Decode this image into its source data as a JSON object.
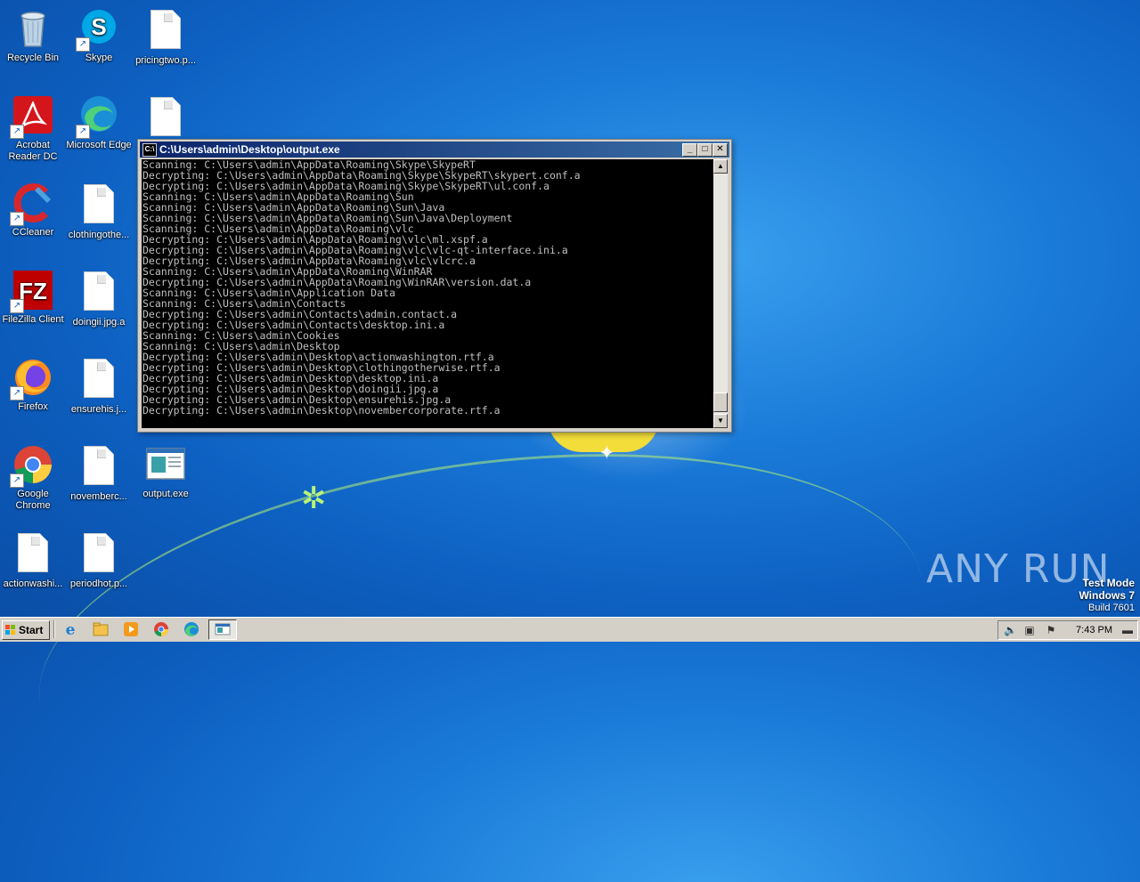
{
  "desktop": {
    "icons": [
      {
        "label": "Recycle Bin"
      },
      {
        "label": "Skype"
      },
      {
        "label": "pricingtwo.p..."
      },
      {
        "label": "Acrobat Reader DC"
      },
      {
        "label": "Microsoft Edge"
      },
      {
        "label": "CCleaner"
      },
      {
        "label": "clothingothe..."
      },
      {
        "label": "FileZilla Client"
      },
      {
        "label": "doingii.jpg.a"
      },
      {
        "label": "Firefox"
      },
      {
        "label": "ensurehis.j..."
      },
      {
        "label": "Google Chrome"
      },
      {
        "label": "novemberc..."
      },
      {
        "label": "output.exe"
      },
      {
        "label": "actionwashi..."
      },
      {
        "label": "periodhot.p..."
      }
    ]
  },
  "console": {
    "title": "C:\\Users\\admin\\Desktop\\output.exe",
    "lines": [
      "Scanning: C:\\Users\\admin\\AppData\\Roaming\\Skype\\SkypeRT",
      "Decrypting: C:\\Users\\admin\\AppData\\Roaming\\Skype\\SkypeRT\\skypert.conf.a",
      "Decrypting: C:\\Users\\admin\\AppData\\Roaming\\Skype\\SkypeRT\\ul.conf.a",
      "Scanning: C:\\Users\\admin\\AppData\\Roaming\\Sun",
      "Scanning: C:\\Users\\admin\\AppData\\Roaming\\Sun\\Java",
      "Scanning: C:\\Users\\admin\\AppData\\Roaming\\Sun\\Java\\Deployment",
      "Scanning: C:\\Users\\admin\\AppData\\Roaming\\vlc",
      "Decrypting: C:\\Users\\admin\\AppData\\Roaming\\vlc\\ml.xspf.a",
      "Decrypting: C:\\Users\\admin\\AppData\\Roaming\\vlc\\vlc-qt-interface.ini.a",
      "Decrypting: C:\\Users\\admin\\AppData\\Roaming\\vlc\\vlcrc.a",
      "Scanning: C:\\Users\\admin\\AppData\\Roaming\\WinRAR",
      "Decrypting: C:\\Users\\admin\\AppData\\Roaming\\WinRAR\\version.dat.a",
      "Scanning: C:\\Users\\admin\\Application Data",
      "Scanning: C:\\Users\\admin\\Contacts",
      "Decrypting: C:\\Users\\admin\\Contacts\\admin.contact.a",
      "Decrypting: C:\\Users\\admin\\Contacts\\desktop.ini.a",
      "Scanning: C:\\Users\\admin\\Cookies",
      "Scanning: C:\\Users\\admin\\Desktop",
      "Decrypting: C:\\Users\\admin\\Desktop\\actionwashington.rtf.a",
      "Decrypting: C:\\Users\\admin\\Desktop\\clothingotherwise.rtf.a",
      "Decrypting: C:\\Users\\admin\\Desktop\\desktop.ini.a",
      "Decrypting: C:\\Users\\admin\\Desktop\\doingii.jpg.a",
      "Decrypting: C:\\Users\\admin\\Desktop\\ensurehis.jpg.a",
      "Decrypting: C:\\Users\\admin\\Desktop\\novembercorporate.rtf.a"
    ]
  },
  "watermark": {
    "text": "ANY RUN"
  },
  "system": {
    "line1": "Test Mode",
    "line2": "Windows 7",
    "line3": "Build 7601"
  },
  "taskbar": {
    "start_label": "Start",
    "clock": "7:43 PM",
    "pinned": [
      "internet-explorer-icon",
      "explorer-icon",
      "media-player-icon",
      "chrome-icon",
      "edge-icon"
    ]
  }
}
